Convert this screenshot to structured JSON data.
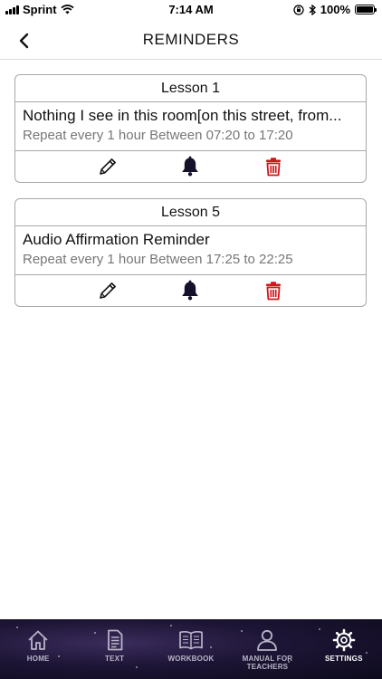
{
  "status_bar": {
    "carrier": "Sprint",
    "time": "7:14 AM",
    "battery_percent": "100%",
    "battery_level": 1.0
  },
  "nav": {
    "title": "REMINDERS",
    "back_icon": "chevron-left-icon"
  },
  "reminders": [
    {
      "lesson": "Lesson 1",
      "title": "Nothing I see in this room[on this street, from...",
      "schedule": "Repeat every 1 hour Between 07:20 to 17:20",
      "actions": {
        "edit_icon": "pencil-icon",
        "notify_icon": "bell-icon",
        "delete_icon": "trash-icon"
      }
    },
    {
      "lesson": "Lesson 5",
      "title": "Audio Affirmation Reminder",
      "schedule": "Repeat every 1 hour Between 17:25 to 22:25",
      "actions": {
        "edit_icon": "pencil-icon",
        "notify_icon": "bell-icon",
        "delete_icon": "trash-icon"
      }
    }
  ],
  "tabbar": {
    "items": [
      {
        "label": "HOME",
        "icon": "home-icon"
      },
      {
        "label": "TEXT",
        "icon": "document-icon"
      },
      {
        "label": "WORKBOOK",
        "icon": "book-icon"
      },
      {
        "label": "MANUAL FOR TEACHERS",
        "icon": "user-icon"
      },
      {
        "label": "SETTINGS",
        "icon": "gear-icon",
        "active": true
      }
    ]
  },
  "colors": {
    "bell": "#15112b",
    "trash": "#d0171b",
    "tabbar_bg": "#1d1535"
  }
}
